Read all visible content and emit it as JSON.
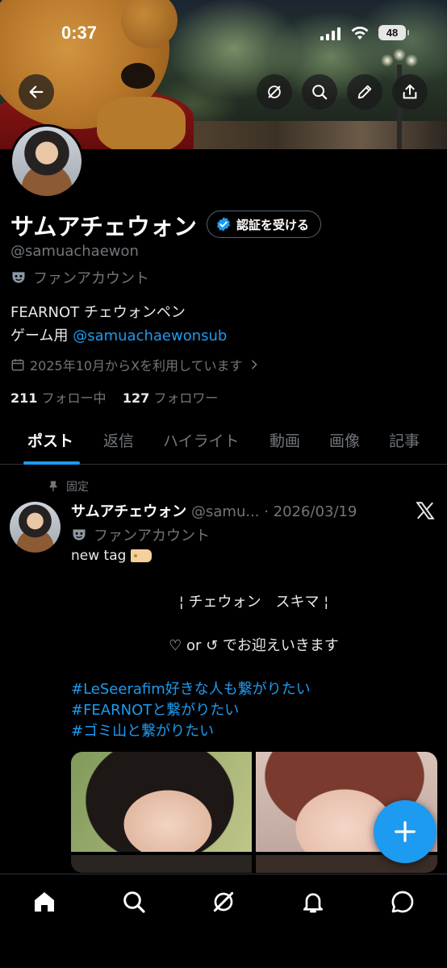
{
  "status_bar": {
    "time": "0:37",
    "battery": "48"
  },
  "header": {
    "back_icon": "arrow-left-icon",
    "grok_icon": "grok-icon",
    "search_icon": "search-icon",
    "edit_icon": "pencil-icon",
    "share_icon": "share-icon"
  },
  "profile": {
    "name": "サムアチェウォン",
    "verify_label": "認証を受ける",
    "handle": "@samuachaewon",
    "label": "ファンアカウント",
    "bio_line1": "FEARNOT チェウォンペン",
    "bio_line2_prefix": "ゲーム用 ",
    "bio_line2_link": "@samuachaewonsub",
    "joined": "2025年10月からXを利用しています",
    "following_count": "211",
    "following_label": "フォロー中",
    "followers_count": "127",
    "followers_label": "フォロワー"
  },
  "tabs": [
    "ポスト",
    "返信",
    "ハイライト",
    "動画",
    "画像",
    "記事"
  ],
  "post": {
    "pinned_label": "固定",
    "name": "サムアチェウォン",
    "handle_date": "@samu... · 2026/03/19",
    "label": "ファンアカウント",
    "text1": "new tag",
    "text2": "¦ チェウォン　スキマ ¦",
    "text3": "♡ or ↺ でお迎えいきます",
    "hashtags": [
      "#LeSeerafim好きな人も繋がりたい",
      "#FEARNOTと繋がりたい",
      "#ゴミ山と繋がりたい"
    ]
  },
  "colors": {
    "accent": "#1d9bf0",
    "muted": "#71767b",
    "background": "#000000"
  },
  "bottom_nav": [
    "home-icon",
    "search-icon",
    "grok-icon",
    "notifications-icon",
    "messages-icon"
  ]
}
